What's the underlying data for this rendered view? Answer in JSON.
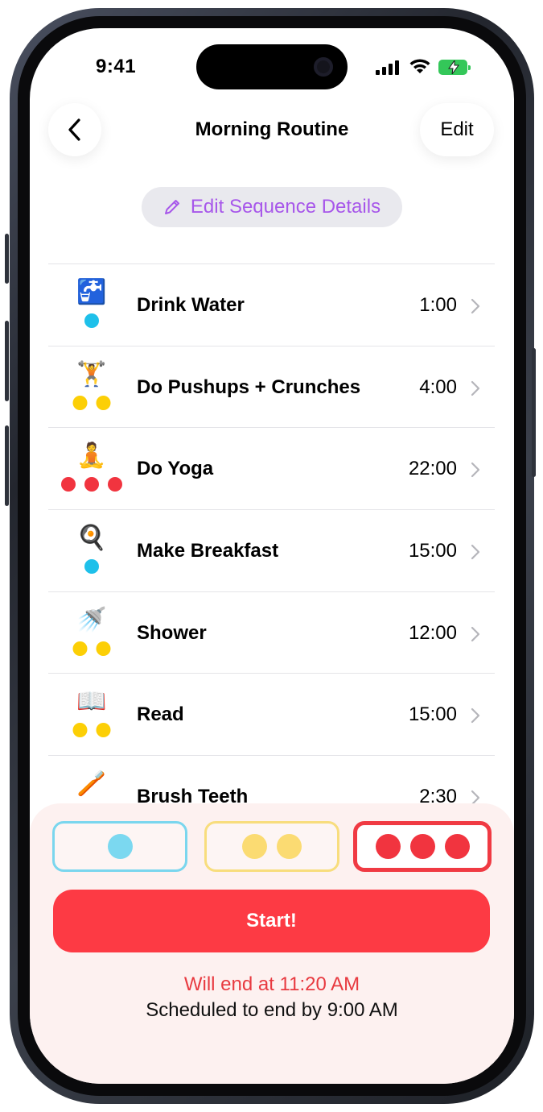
{
  "status_bar": {
    "time": "9:41"
  },
  "nav": {
    "back_label": "Back",
    "title": "Morning Routine",
    "edit_label": "Edit"
  },
  "edit_sequence_label": "Edit Sequence Details",
  "colors": {
    "low": "#1ec0ea",
    "medium": "#fccf06",
    "high": "#f1343f",
    "accent_purple": "#a757ea",
    "start_red": "#fd3a44"
  },
  "tasks": [
    {
      "title": "Drink Water",
      "time": "1:00",
      "emoji": "🚰",
      "energy": 1,
      "dot_color": "#1ec0ea"
    },
    {
      "title": "Do Pushups + Crunches",
      "time": "4:00",
      "emoji": "🏋",
      "energy": 2,
      "dot_color": "#fccf06"
    },
    {
      "title": "Do Yoga",
      "time": "22:00",
      "emoji": "🧘",
      "energy": 3,
      "dot_color": "#f1343f"
    },
    {
      "title": "Make Breakfast",
      "time": "15:00",
      "emoji": "🍳",
      "energy": 1,
      "dot_color": "#1ec0ea"
    },
    {
      "title": "Shower",
      "time": "12:00",
      "emoji": "🚿",
      "energy": 2,
      "dot_color": "#fccf06"
    },
    {
      "title": "Read",
      "time": "15:00",
      "emoji": "📖",
      "energy": 2,
      "dot_color": "#fccf06"
    },
    {
      "title": "Brush Teeth",
      "time": "2:30",
      "emoji": "🪥",
      "energy": 0,
      "dot_color": "#fccf06"
    }
  ],
  "energy_options": [
    {
      "level": 1,
      "color": "#7bd8f0",
      "selected": false
    },
    {
      "level": 2,
      "color": "#fbdb72",
      "selected": false
    },
    {
      "level": 3,
      "color": "#f1343f",
      "selected": true
    }
  ],
  "start_label": "Start!",
  "end_estimate": "Will end at 11:20 AM",
  "scheduled_end": "Scheduled to end by 9:00 AM"
}
